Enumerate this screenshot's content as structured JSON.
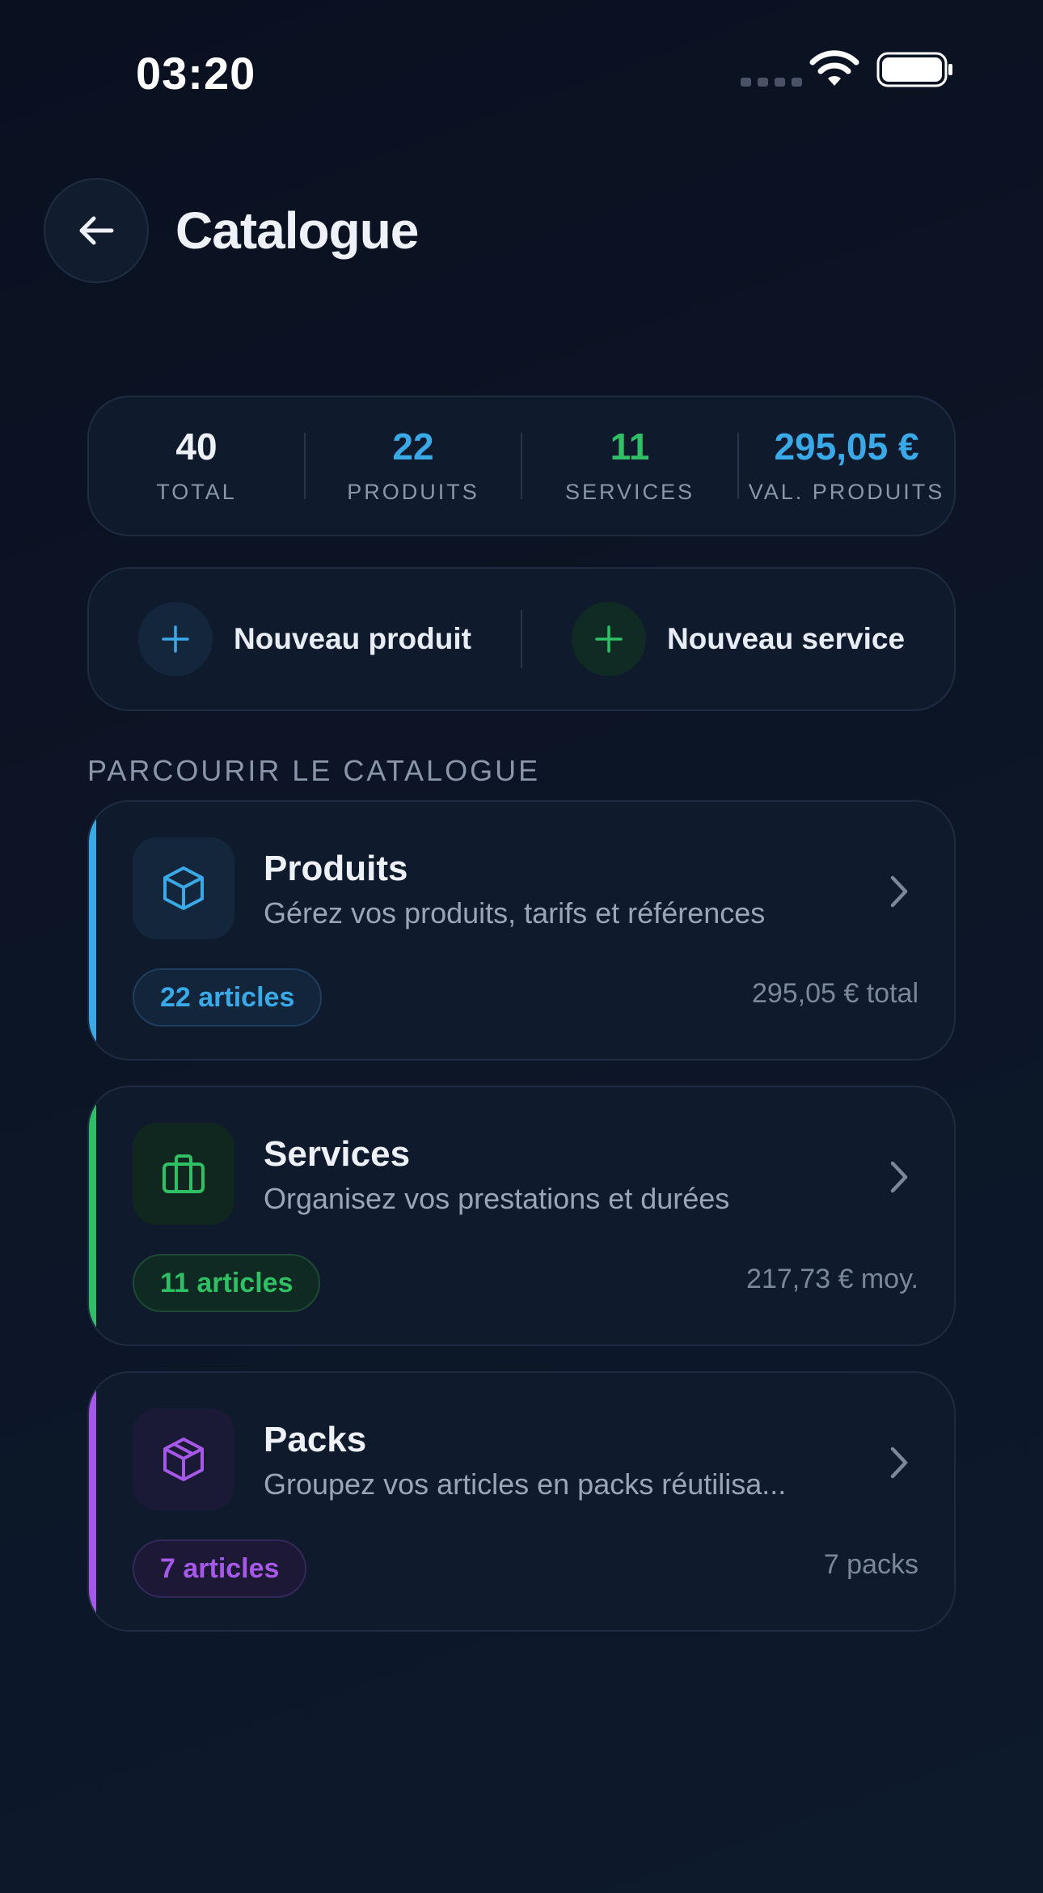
{
  "status_bar": {
    "time": "03:20"
  },
  "header": {
    "title": "Catalogue",
    "back_icon": "arrow-left-icon"
  },
  "stats": [
    {
      "value": "40",
      "label": "TOTAL",
      "color": "#eef2f8"
    },
    {
      "value": "22",
      "label": "PRODUITS",
      "color": "#3aa9e8"
    },
    {
      "value": "11",
      "label": "SERVICES",
      "color": "#2fbf64"
    },
    {
      "value": "295,05 €",
      "label": "VAL. PRODUITS",
      "color": "#3aa9e8"
    }
  ],
  "actions": {
    "new_product": {
      "label": "Nouveau produit",
      "icon": "plus-icon",
      "color": "#3aa9e8"
    },
    "new_service": {
      "label": "Nouveau service",
      "icon": "plus-icon",
      "color": "#2fbf64"
    }
  },
  "section": {
    "title": "PARCOURIR LE CATALOGUE"
  },
  "categories": [
    {
      "title": "Produits",
      "description": "Gérez vos produits, tarifs et références",
      "badge": "22 articles",
      "meta": "295,05 € total",
      "icon": "cube-icon",
      "accent": "#3aa9e8"
    },
    {
      "title": "Services",
      "description": "Organisez vos prestations et durées",
      "badge": "11 articles",
      "meta": "217,73 € moy.",
      "icon": "briefcase-icon",
      "accent": "#2fbf64"
    },
    {
      "title": "Packs",
      "description": "Groupez vos articles en packs réutilisa...",
      "badge": "7 articles",
      "meta": "7 packs",
      "icon": "package-icon",
      "accent": "#a659e8"
    }
  ]
}
